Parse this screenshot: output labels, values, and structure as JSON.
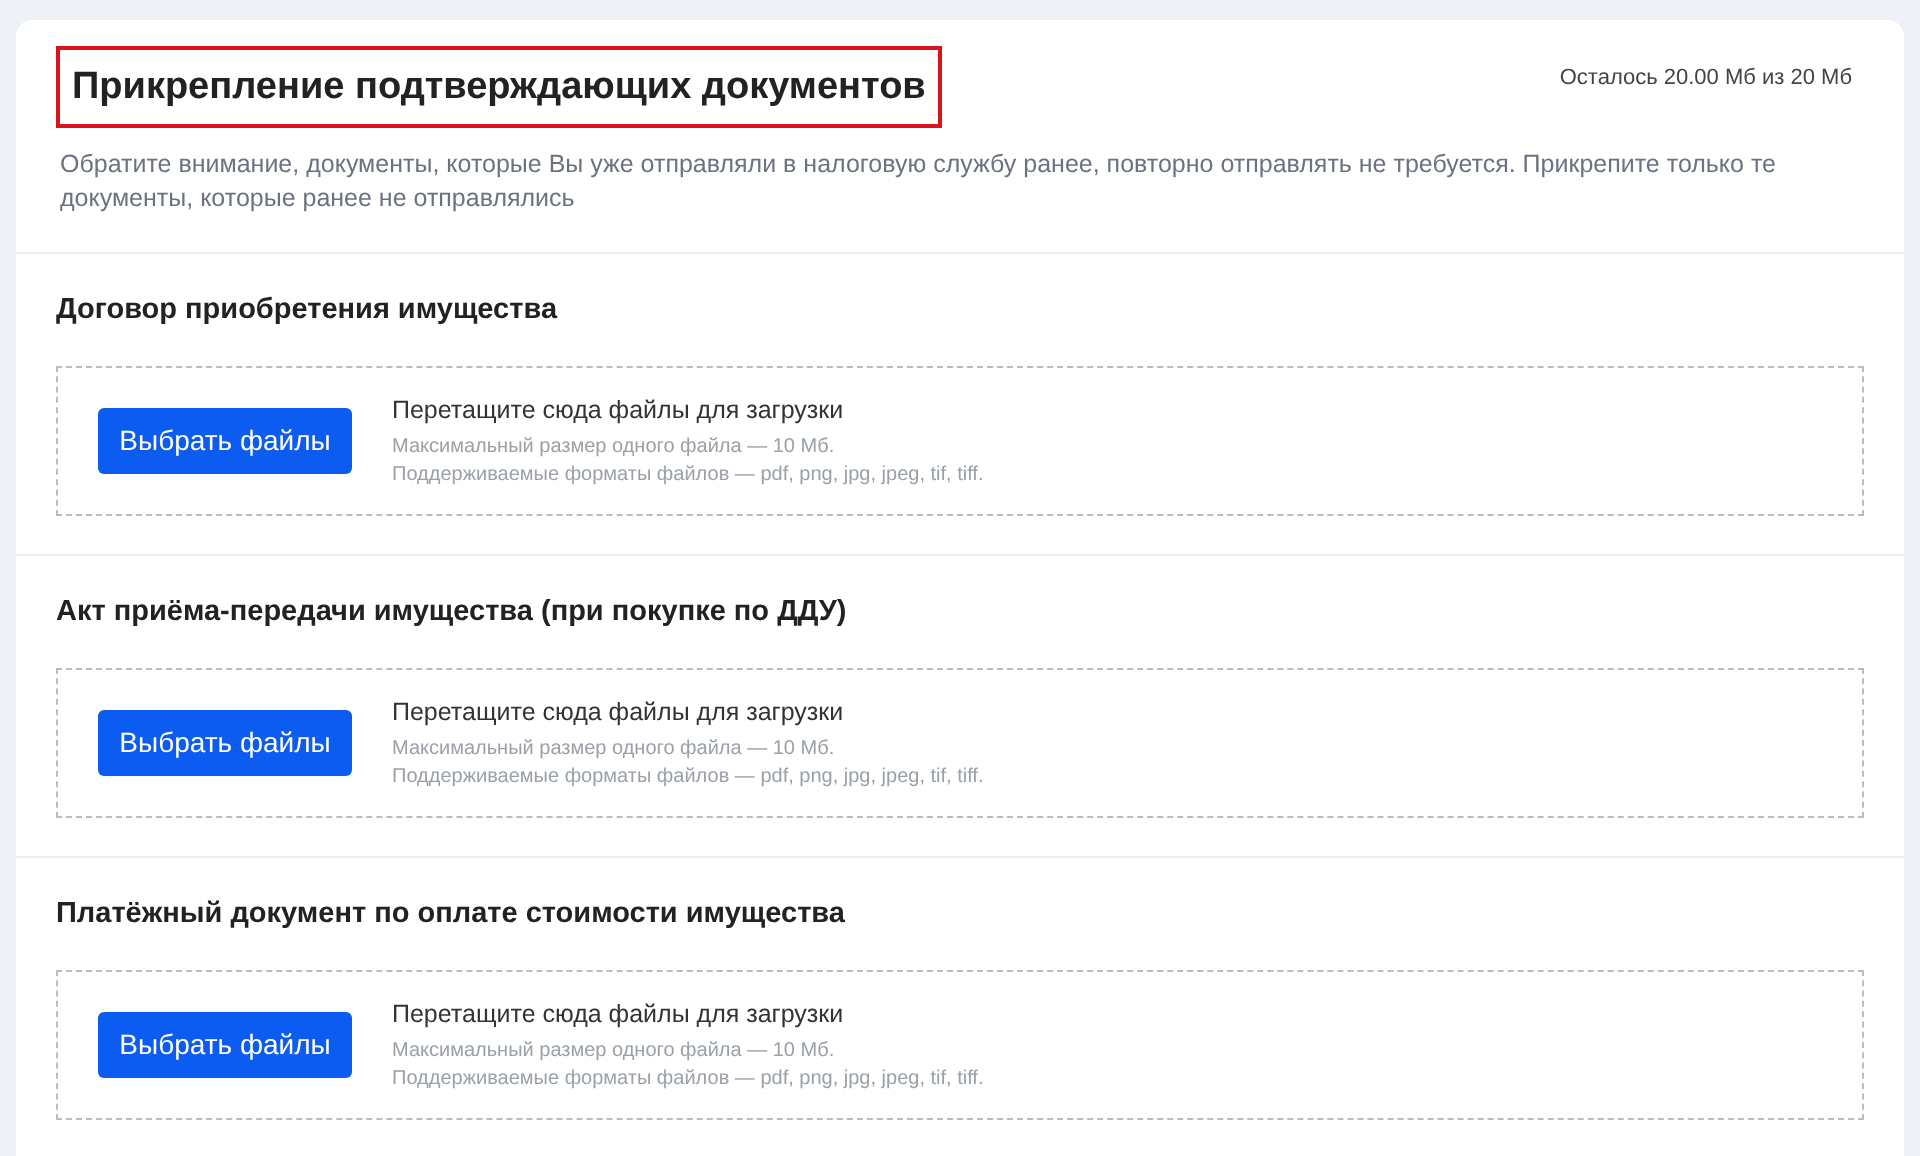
{
  "header": {
    "title": "Прикрепление подтверждающих документов",
    "title_highlighted": true,
    "quota": "Осталось 20.00 Мб из 20 Мб",
    "notice": "Обратите внимание, документы, которые Вы уже отправляли в налоговую службу ранее, повторно отправлять не требуется. Прикрепите только те документы, которые ранее не отправлялись"
  },
  "sections": [
    {
      "title": "Договор приобретения имущества",
      "button": "Выбрать файлы",
      "drop_hint": "Перетащите сюда файлы для загрузки",
      "max_size": "Максимальный размер одного файла — 10 Мб.",
      "formats": "Поддерживаемые форматы файлов — pdf, png, jpg, jpeg, tif, tiff."
    },
    {
      "title": "Акт приёма-передачи имущества (при покупке по ДДУ)",
      "button": "Выбрать файлы",
      "drop_hint": "Перетащите сюда файлы для загрузки",
      "max_size": "Максимальный размер одного файла — 10 Мб.",
      "formats": "Поддерживаемые форматы файлов — pdf, png, jpg, jpeg, tif, tiff."
    },
    {
      "title": "Платёжный документ по оплате стоимости имущества",
      "button": "Выбрать файлы",
      "drop_hint": "Перетащите сюда файлы для загрузки",
      "max_size": "Максимальный размер одного файла — 10 Мб.",
      "formats": "Поддерживаемые форматы файлов — pdf, png, jpg, jpeg, tif, tiff."
    }
  ]
}
